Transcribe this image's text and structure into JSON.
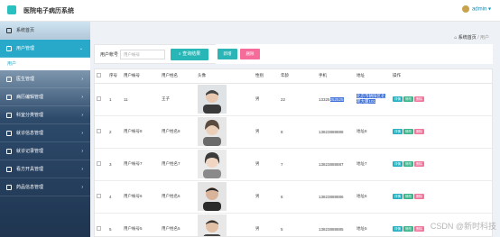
{
  "header": {
    "app_title": "医院电子病历系统",
    "user": "admin"
  },
  "sidebar": {
    "items": [
      {
        "label": "系统首页",
        "top": true
      },
      {
        "label": "用户管理",
        "active": true
      },
      {
        "label": "医生管理"
      },
      {
        "label": "病历编辑管理"
      },
      {
        "label": "科室分类管理"
      },
      {
        "label": "就诊信息管理"
      },
      {
        "label": "就诊记录管理"
      },
      {
        "label": "看方开具管理"
      },
      {
        "label": "药品信息管理"
      }
    ],
    "submenu": "用户"
  },
  "breadcrumb": {
    "home": "系统首页",
    "sep": "/",
    "current": "用户"
  },
  "search": {
    "label": "用户帐号",
    "placeholder": "用户帐号",
    "button": "查询结果"
  },
  "actions": {
    "add": "新增",
    "delete": "删除"
  },
  "table": {
    "headers": [
      "",
      "序号",
      "用户帐号",
      "用户姓名",
      "头像",
      "性别",
      "年龄",
      "手机",
      "地址",
      "操作"
    ],
    "rows": [
      {
        "no": "1",
        "account": "11",
        "name": "王子",
        "gender": "男",
        "age": "22",
        "phone_a": "13325",
        "phone_b": "252525",
        "addr_a": "北京市朝阳区北",
        "addr_b": "苑大厦101"
      },
      {
        "no": "2",
        "account": "用户帐号8",
        "name": "用户姓名8",
        "gender": "男",
        "age": "8",
        "phone_a": "13823888888",
        "phone_b": "",
        "addr_a": "地址8",
        "addr_b": ""
      },
      {
        "no": "3",
        "account": "用户帐号7",
        "name": "用户姓名7",
        "gender": "男",
        "age": "7",
        "phone_a": "13823888887",
        "phone_b": "",
        "addr_a": "地址7",
        "addr_b": ""
      },
      {
        "no": "4",
        "account": "用户帐号6",
        "name": "用户姓名6",
        "gender": "男",
        "age": "6",
        "phone_a": "13823888886",
        "phone_b": "",
        "addr_a": "地址6",
        "addr_b": ""
      },
      {
        "no": "5",
        "account": "用户帐号5",
        "name": "用户姓名5",
        "gender": "男",
        "age": "5",
        "phone_a": "13823888885",
        "phone_b": "",
        "addr_a": "地址5",
        "addr_b": ""
      }
    ],
    "ops": {
      "view": "详情",
      "edit": "修改",
      "del": "删除"
    }
  },
  "watermark": "CSDN @新时科技",
  "colors": {
    "accent": "#29b6b6",
    "danger": "#f56c9a",
    "sidebar_active": "#29a9c9"
  }
}
